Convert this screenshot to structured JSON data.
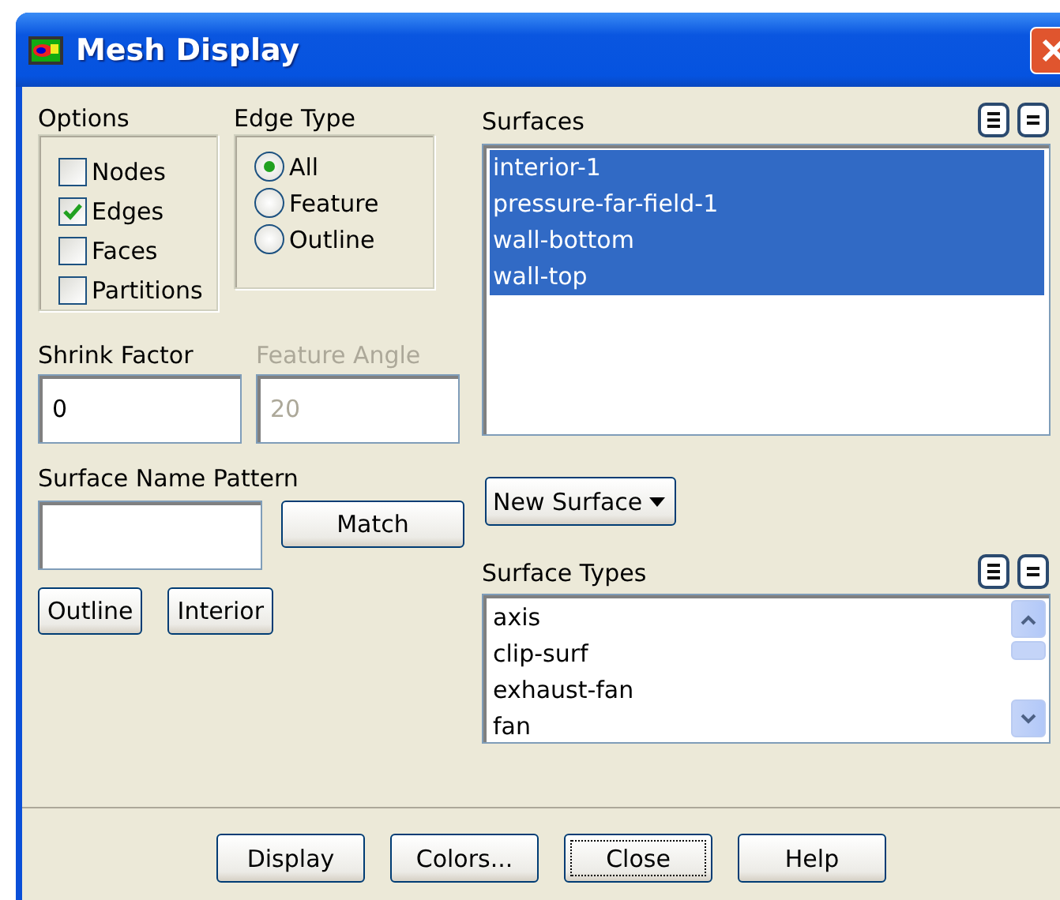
{
  "window": {
    "title": "Mesh Display"
  },
  "options": {
    "label": "Options",
    "items": [
      {
        "label": "Nodes",
        "checked": false
      },
      {
        "label": "Edges",
        "checked": true
      },
      {
        "label": "Faces",
        "checked": false
      },
      {
        "label": "Partitions",
        "checked": false
      }
    ]
  },
  "edge_type": {
    "label": "Edge Type",
    "items": [
      {
        "label": "All",
        "selected": true
      },
      {
        "label": "Feature",
        "selected": false
      },
      {
        "label": "Outline",
        "selected": false
      }
    ]
  },
  "shrink_factor": {
    "label": "Shrink Factor",
    "value": "0",
    "disabled": false
  },
  "feature_angle": {
    "label": "Feature Angle",
    "value": "20",
    "disabled": true
  },
  "surface_name_pattern": {
    "label": "Surface Name Pattern",
    "button": "Match"
  },
  "pattern_buttons": [
    "Outline",
    "Interior"
  ],
  "surfaces": {
    "label": "Surfaces",
    "items": [
      {
        "label": "interior-1",
        "selected": true
      },
      {
        "label": "pressure-far-field-1",
        "selected": true
      },
      {
        "label": "wall-bottom",
        "selected": true
      },
      {
        "label": "wall-top",
        "selected": true
      }
    ]
  },
  "new_surface": {
    "label": "New Surface"
  },
  "surface_types": {
    "label": "Surface Types",
    "items": [
      {
        "label": "axis",
        "selected": false
      },
      {
        "label": "clip-surf",
        "selected": false
      },
      {
        "label": "exhaust-fan",
        "selected": false
      },
      {
        "label": "fan",
        "selected": false
      }
    ]
  },
  "buttons": [
    {
      "label": "Display",
      "focused": false
    },
    {
      "label": "Colors...",
      "focused": false
    },
    {
      "label": "Close",
      "focused": true
    },
    {
      "label": "Help",
      "focused": false
    }
  ]
}
